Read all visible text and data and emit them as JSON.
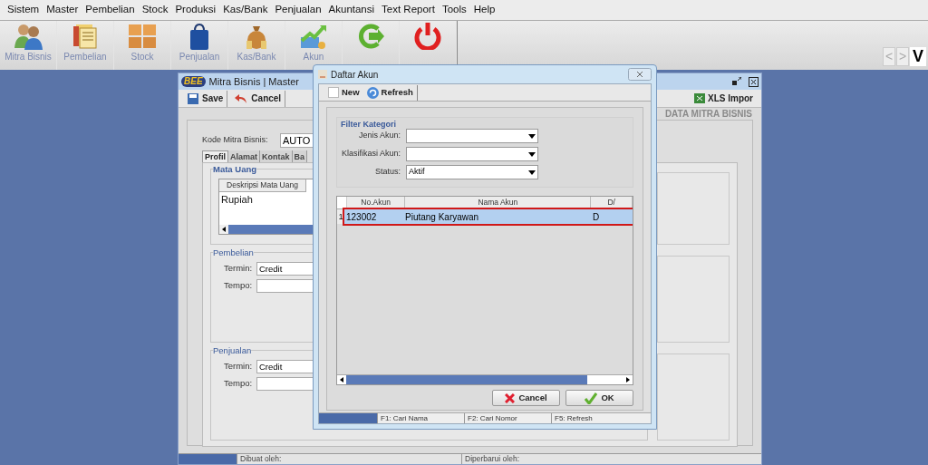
{
  "menu_bar": [
    "Sistem",
    "Master",
    "Pembelian",
    "Stock",
    "Produksi",
    "Kas/Bank",
    "Penjualan",
    "Akuntansi",
    "Text Report",
    "Tools",
    "Help"
  ],
  "toolbar": [
    {
      "label": "Mitra Bisnis"
    },
    {
      "label": "Pembelian"
    },
    {
      "label": "Stock"
    },
    {
      "label": "Penjualan"
    },
    {
      "label": "Kas/Bank"
    },
    {
      "label": "Akun"
    }
  ],
  "nav_buttons": [
    "<",
    ">",
    "V"
  ],
  "main_window": {
    "logo": "BEE",
    "title": "Mitra Bisnis | Master",
    "actions": [
      {
        "label": "Save"
      },
      {
        "label": "Cancel"
      }
    ],
    "import_button": "XLS Impor",
    "section_title": "DATA MITRA BISNIS",
    "code_label": "Kode Mitra Bisnis:",
    "code_value": "AUTO",
    "tabs": [
      {
        "label": "Profil",
        "selected": true
      },
      {
        "label": "Alamat",
        "selected": false
      },
      {
        "label": "Kontak",
        "selected": false
      },
      {
        "label": "Ba",
        "selected": false
      }
    ],
    "currency_group": {
      "title": "Mata Uang",
      "column": "Deskripsi Mata Uang",
      "rows": [
        "Rupiah"
      ]
    },
    "groups": [
      {
        "title": "Pembelian",
        "term_label": "Termin:",
        "term_value": "Credit",
        "tempo_label": "Tempo:"
      },
      {
        "title": "Penjualan",
        "term_label": "Termin:",
        "term_value": "Credit",
        "tempo_label": "Tempo:"
      }
    ],
    "status_bar": [
      "Dibuat oleh:",
      "Diperbarui oleh:"
    ]
  },
  "dialog": {
    "title": "Daftar Akun",
    "actions": [
      {
        "label": "New"
      },
      {
        "label": "Refresh"
      }
    ],
    "filter": {
      "title": "Filter Kategori",
      "fields": [
        {
          "label": "Jenis Akun:"
        },
        {
          "label": "Klasifikasi Akun:"
        },
        {
          "label": "Status:",
          "value": "Aktif"
        }
      ]
    },
    "table": {
      "columns": [
        "No.Akun",
        "Nama Akun",
        "D/"
      ],
      "rows": [
        {
          "index": "1",
          "cells": [
            "123002",
            "Piutang Karyawan",
            "D"
          ],
          "selected": true
        }
      ]
    },
    "buttons": [
      {
        "label": "Cancel",
        "kind": "cancel"
      },
      {
        "label": "OK",
        "kind": "ok"
      }
    ],
    "status_bar": [
      "F1: Cari Nama",
      "F2: Cari Nomor",
      "F5: Refresh"
    ]
  }
}
